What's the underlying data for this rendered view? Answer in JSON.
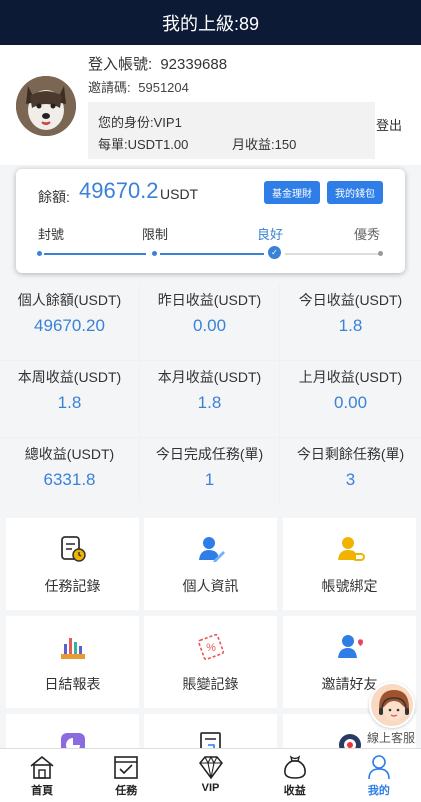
{
  "header": {
    "title": "我的上級:89"
  },
  "profile": {
    "account_label": "登入帳號:",
    "account_value": "92339688",
    "invite_label": "邀請碼:",
    "invite_value": "5951204",
    "identity": "您的身份:VIP1",
    "order": "每單:USDT1.00",
    "monthly": "月收益:150",
    "logout": "登出"
  },
  "balance": {
    "label": "餘額:",
    "value": "49670.2",
    "unit": "USDT",
    "btn_fund": "基金理財",
    "btn_wallet": "我的錢包",
    "levels": [
      "封號",
      "限制",
      "良好",
      "優秀"
    ],
    "current_level": "良好"
  },
  "stats": [
    {
      "label": "個人餘額(USDT)",
      "value": "49670.20"
    },
    {
      "label": "昨日收益(USDT)",
      "value": "0.00"
    },
    {
      "label": "今日收益(USDT)",
      "value": "1.8"
    },
    {
      "label": "本周收益(USDT)",
      "value": "1.8"
    },
    {
      "label": "本月收益(USDT)",
      "value": "1.8"
    },
    {
      "label": "上月收益(USDT)",
      "value": "0.00"
    },
    {
      "label": "總收益(USDT)",
      "value": "6331.8"
    },
    {
      "label": "今日完成任務(單)",
      "value": "1"
    },
    {
      "label": "今日剩餘任務(單)",
      "value": "3"
    }
  ],
  "menu": [
    {
      "label": "任務記錄",
      "icon": "task-record-icon"
    },
    {
      "label": "個人資訊",
      "icon": "user-edit-icon"
    },
    {
      "label": "帳號綁定",
      "icon": "user-link-icon"
    },
    {
      "label": "日結報表",
      "icon": "bar-chart-icon"
    },
    {
      "label": "賬變記錄",
      "icon": "percent-tag-icon"
    },
    {
      "label": "邀請好友",
      "icon": "user-heart-icon"
    },
    {
      "label": "",
      "icon": "pie-chart-icon"
    },
    {
      "label": "",
      "icon": "document-icon"
    },
    {
      "label": "",
      "icon": "badge-icon"
    }
  ],
  "customer_service": {
    "label": "線上客服"
  },
  "tabbar": [
    {
      "label": "首頁",
      "icon": "home-icon"
    },
    {
      "label": "任務",
      "icon": "task-icon"
    },
    {
      "label": "VIP",
      "icon": "diamond-icon"
    },
    {
      "label": "收益",
      "icon": "money-bag-icon"
    },
    {
      "label": "我的",
      "icon": "user-icon",
      "active": true
    }
  ],
  "colors": {
    "header_bg": "#0d1a36",
    "accent": "#3a82d6",
    "button": "#2f7ee8"
  }
}
